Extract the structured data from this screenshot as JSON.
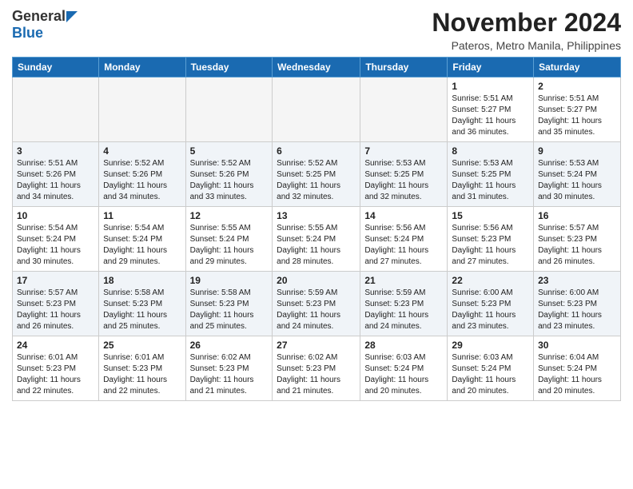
{
  "header": {
    "logo_general": "General",
    "logo_blue": "Blue",
    "month": "November 2024",
    "location": "Pateros, Metro Manila, Philippines"
  },
  "days_of_week": [
    "Sunday",
    "Monday",
    "Tuesday",
    "Wednesday",
    "Thursday",
    "Friday",
    "Saturday"
  ],
  "weeks": [
    {
      "days": [
        {
          "num": "",
          "info": "",
          "empty": true
        },
        {
          "num": "",
          "info": "",
          "empty": true
        },
        {
          "num": "",
          "info": "",
          "empty": true
        },
        {
          "num": "",
          "info": "",
          "empty": true
        },
        {
          "num": "",
          "info": "",
          "empty": true
        },
        {
          "num": "1",
          "info": "Sunrise: 5:51 AM\nSunset: 5:27 PM\nDaylight: 11 hours\nand 36 minutes."
        },
        {
          "num": "2",
          "info": "Sunrise: 5:51 AM\nSunset: 5:27 PM\nDaylight: 11 hours\nand 35 minutes."
        }
      ]
    },
    {
      "days": [
        {
          "num": "3",
          "info": "Sunrise: 5:51 AM\nSunset: 5:26 PM\nDaylight: 11 hours\nand 34 minutes."
        },
        {
          "num": "4",
          "info": "Sunrise: 5:52 AM\nSunset: 5:26 PM\nDaylight: 11 hours\nand 34 minutes."
        },
        {
          "num": "5",
          "info": "Sunrise: 5:52 AM\nSunset: 5:26 PM\nDaylight: 11 hours\nand 33 minutes."
        },
        {
          "num": "6",
          "info": "Sunrise: 5:52 AM\nSunset: 5:25 PM\nDaylight: 11 hours\nand 32 minutes."
        },
        {
          "num": "7",
          "info": "Sunrise: 5:53 AM\nSunset: 5:25 PM\nDaylight: 11 hours\nand 32 minutes."
        },
        {
          "num": "8",
          "info": "Sunrise: 5:53 AM\nSunset: 5:25 PM\nDaylight: 11 hours\nand 31 minutes."
        },
        {
          "num": "9",
          "info": "Sunrise: 5:53 AM\nSunset: 5:24 PM\nDaylight: 11 hours\nand 30 minutes."
        }
      ]
    },
    {
      "days": [
        {
          "num": "10",
          "info": "Sunrise: 5:54 AM\nSunset: 5:24 PM\nDaylight: 11 hours\nand 30 minutes."
        },
        {
          "num": "11",
          "info": "Sunrise: 5:54 AM\nSunset: 5:24 PM\nDaylight: 11 hours\nand 29 minutes."
        },
        {
          "num": "12",
          "info": "Sunrise: 5:55 AM\nSunset: 5:24 PM\nDaylight: 11 hours\nand 29 minutes."
        },
        {
          "num": "13",
          "info": "Sunrise: 5:55 AM\nSunset: 5:24 PM\nDaylight: 11 hours\nand 28 minutes."
        },
        {
          "num": "14",
          "info": "Sunrise: 5:56 AM\nSunset: 5:24 PM\nDaylight: 11 hours\nand 27 minutes."
        },
        {
          "num": "15",
          "info": "Sunrise: 5:56 AM\nSunset: 5:23 PM\nDaylight: 11 hours\nand 27 minutes."
        },
        {
          "num": "16",
          "info": "Sunrise: 5:57 AM\nSunset: 5:23 PM\nDaylight: 11 hours\nand 26 minutes."
        }
      ]
    },
    {
      "days": [
        {
          "num": "17",
          "info": "Sunrise: 5:57 AM\nSunset: 5:23 PM\nDaylight: 11 hours\nand 26 minutes."
        },
        {
          "num": "18",
          "info": "Sunrise: 5:58 AM\nSunset: 5:23 PM\nDaylight: 11 hours\nand 25 minutes."
        },
        {
          "num": "19",
          "info": "Sunrise: 5:58 AM\nSunset: 5:23 PM\nDaylight: 11 hours\nand 25 minutes."
        },
        {
          "num": "20",
          "info": "Sunrise: 5:59 AM\nSunset: 5:23 PM\nDaylight: 11 hours\nand 24 minutes."
        },
        {
          "num": "21",
          "info": "Sunrise: 5:59 AM\nSunset: 5:23 PM\nDaylight: 11 hours\nand 24 minutes."
        },
        {
          "num": "22",
          "info": "Sunrise: 6:00 AM\nSunset: 5:23 PM\nDaylight: 11 hours\nand 23 minutes."
        },
        {
          "num": "23",
          "info": "Sunrise: 6:00 AM\nSunset: 5:23 PM\nDaylight: 11 hours\nand 23 minutes."
        }
      ]
    },
    {
      "days": [
        {
          "num": "24",
          "info": "Sunrise: 6:01 AM\nSunset: 5:23 PM\nDaylight: 11 hours\nand 22 minutes."
        },
        {
          "num": "25",
          "info": "Sunrise: 6:01 AM\nSunset: 5:23 PM\nDaylight: 11 hours\nand 22 minutes."
        },
        {
          "num": "26",
          "info": "Sunrise: 6:02 AM\nSunset: 5:23 PM\nDaylight: 11 hours\nand 21 minutes."
        },
        {
          "num": "27",
          "info": "Sunrise: 6:02 AM\nSunset: 5:23 PM\nDaylight: 11 hours\nand 21 minutes."
        },
        {
          "num": "28",
          "info": "Sunrise: 6:03 AM\nSunset: 5:24 PM\nDaylight: 11 hours\nand 20 minutes."
        },
        {
          "num": "29",
          "info": "Sunrise: 6:03 AM\nSunset: 5:24 PM\nDaylight: 11 hours\nand 20 minutes."
        },
        {
          "num": "30",
          "info": "Sunrise: 6:04 AM\nSunset: 5:24 PM\nDaylight: 11 hours\nand 20 minutes."
        }
      ]
    }
  ]
}
